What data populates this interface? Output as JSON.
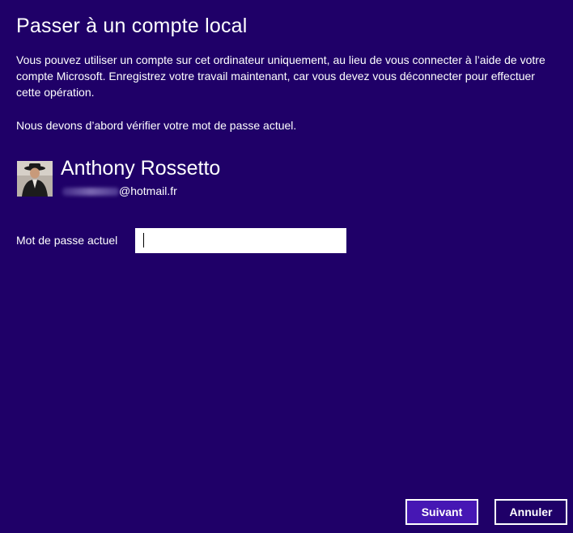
{
  "title": "Passer à un compte local",
  "description": "Vous pouvez utiliser un compte sur cet ordinateur uniquement, au lieu de vous connecter à l’aide de votre compte Microsoft. Enregistrez votre travail maintenant, car vous devez vous déconnecter pour effectuer cette opération.",
  "verify_text": "Nous devons d’abord vérifier votre mot de passe actuel.",
  "account": {
    "name": "Anthony Rossetto",
    "email_domain": "@hotmail.fr"
  },
  "password": {
    "label": "Mot de passe actuel",
    "value": ""
  },
  "buttons": {
    "next": "Suivant",
    "cancel": "Annuler"
  },
  "colors": {
    "background": "#1f0068",
    "primary_button": "#4617b4",
    "text": "#ffffff"
  }
}
